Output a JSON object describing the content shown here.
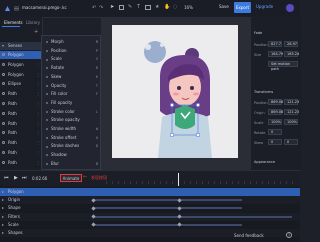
{
  "header": {
    "file_name": "macsamerai.pmgo-.kc",
    "zoom": "16%",
    "save_label": "Save",
    "export_label": "Export",
    "upgrade_label": "Upgrade"
  },
  "left_panel": {
    "tabs": [
      "Elements",
      "Library"
    ],
    "group_label": "Senses",
    "layers": [
      "Polygon",
      "Polygon",
      "Polygon",
      "Ellipse",
      "Path",
      "Path",
      "Path",
      "Path",
      "Path",
      "Path",
      "Path",
      "Path"
    ]
  },
  "context_menu": {
    "items": [
      {
        "label": "Morph",
        "key": "M"
      },
      {
        "label": "Position",
        "key": "P"
      },
      {
        "label": "Scale",
        "key": "S"
      },
      {
        "label": "Rotate",
        "key": "R"
      },
      {
        "label": "Skew",
        "key": "K"
      },
      {
        "label": "Opacity",
        "key": "T"
      },
      {
        "label": "Fill color",
        "key": "F"
      },
      {
        "label": "Fill opacity",
        "key": ""
      },
      {
        "label": "Stroke color",
        "key": "L"
      },
      {
        "label": "Stroke opacity",
        "key": ""
      },
      {
        "label": "Stroke width",
        "key": "W"
      },
      {
        "label": "Stroke offset",
        "key": "O"
      },
      {
        "label": "Stroke dashes",
        "key": "D"
      },
      {
        "label": "Shadow",
        "key": ""
      },
      {
        "label": "Blur",
        "key": "B"
      }
    ]
  },
  "right_panel": {
    "section_label": "Fade",
    "position_label": "Position",
    "position_x": "827.7",
    "position_y": "28.97",
    "size_label": "Size",
    "size_w": "164.79",
    "size_h": "165.24",
    "motion_path_btn": "Set motion path",
    "transform_label": "Transforms",
    "t_position_label": "Position",
    "t_position_x": "869.08",
    "t_position_y": "121.23",
    "origin_label": "Origin",
    "origin_x": "869.08",
    "origin_y": "121.23",
    "scale_label": "Scale",
    "scale_x": "100%",
    "scale_y": "100%",
    "rotate_label": "Rotate",
    "rotate_val": "0",
    "skew_label": "Skew",
    "skew_x": "0",
    "skew_y": "0",
    "appearance_label": "Appearance"
  },
  "playback": {
    "time": "0:02.66",
    "animate_label": "Animate",
    "annotation": "发现按钮"
  },
  "timeline": {
    "rows": [
      "Polygon",
      "Origin",
      "Shape",
      "Filters",
      "Scale",
      "Shapes"
    ],
    "send_feedback": "Send feedback"
  },
  "colors": {
    "accent": "#3d7be0",
    "upgrade": "#3571d8",
    "highlight_row": "#2f5fb3",
    "annotation_red": "#e23b3b"
  }
}
